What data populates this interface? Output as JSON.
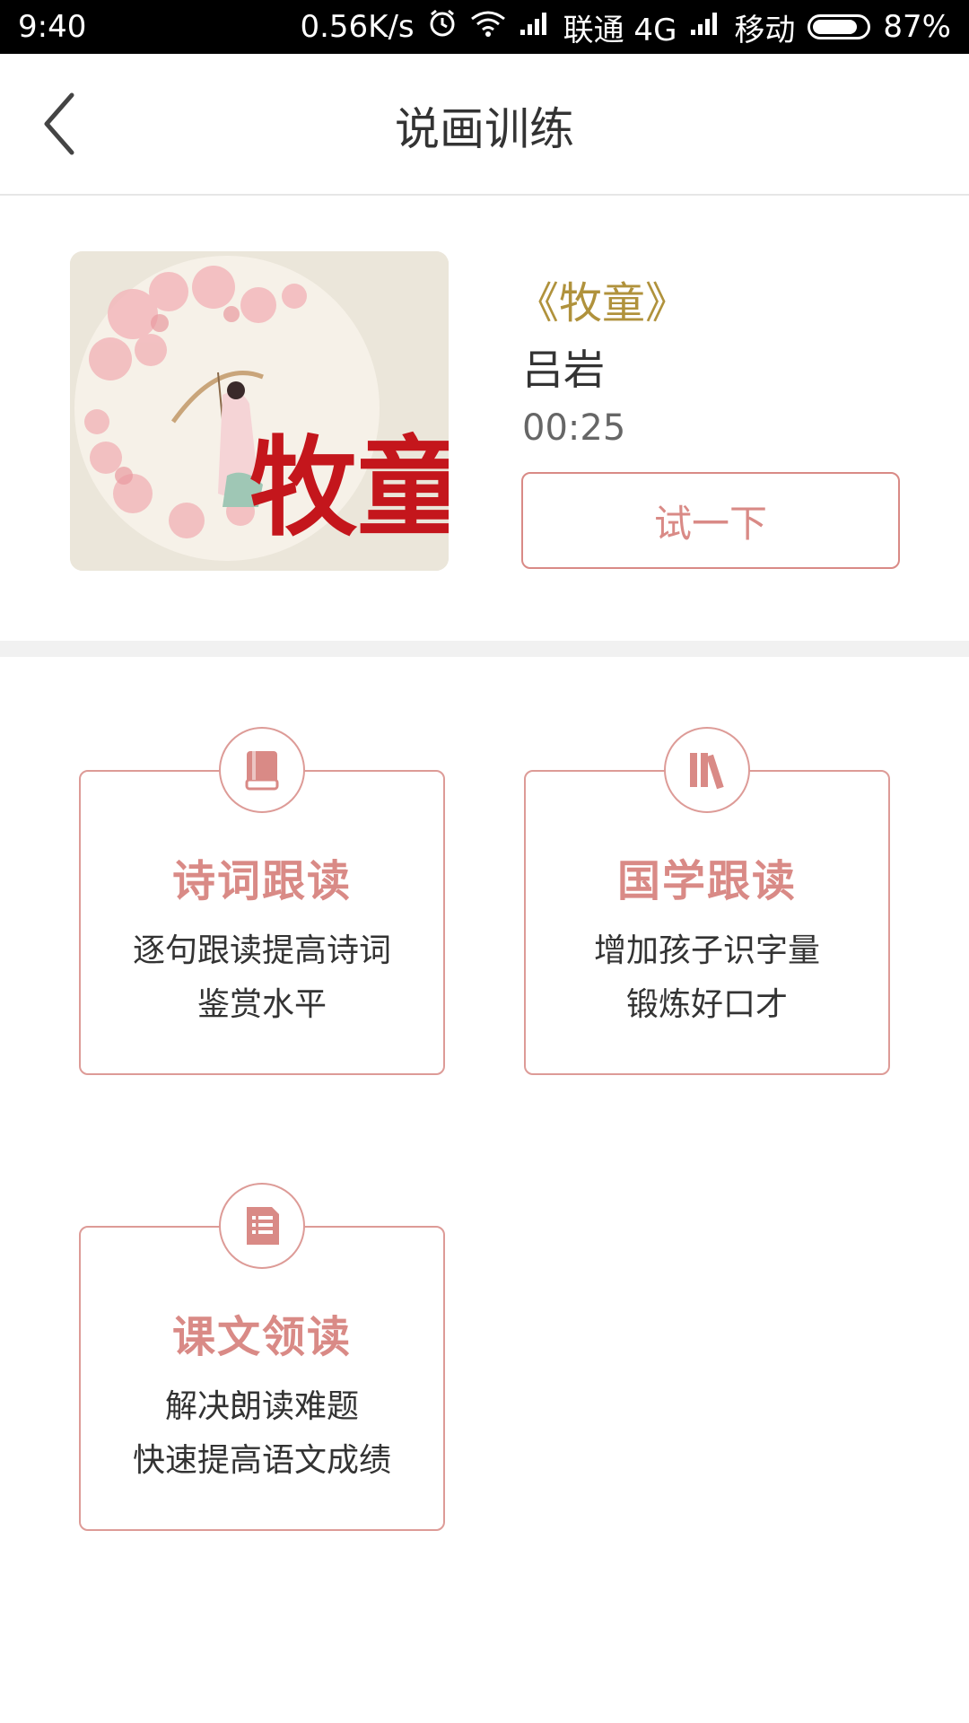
{
  "status_bar": {
    "time": "9:40",
    "speed": "0.56K/s",
    "carrier1": "联通 4G",
    "carrier2": "移动",
    "battery": "87%",
    "battery_level": 0.87,
    "icons": [
      "alarm-icon",
      "wifi-icon",
      "signal-icon",
      "signal-icon",
      "battery-icon"
    ]
  },
  "header": {
    "title": "说画训练",
    "back_icon": "chevron-left-icon"
  },
  "featured": {
    "title": "《牧童》",
    "author": "吕岩",
    "duration": "00:25",
    "try_label": "试一下",
    "cover_text": "牧童"
  },
  "cards": [
    {
      "title": "诗词跟读",
      "desc_line1": "逐句跟读提高诗词",
      "desc_line2": "鉴赏水平",
      "icon": "book-icon"
    },
    {
      "title": "国学跟读",
      "desc_line1": "增加孩子识字量",
      "desc_line2": "锻炼好口才",
      "icon": "books-icon"
    },
    {
      "title": "课文领读",
      "desc_line1": "解决朗读难题",
      "desc_line2": "快速提高语文成绩",
      "icon": "document-icon"
    }
  ],
  "colors": {
    "accent": "#d98a86",
    "title_gold": "#b0923c",
    "divider": "#f1f1f1"
  }
}
